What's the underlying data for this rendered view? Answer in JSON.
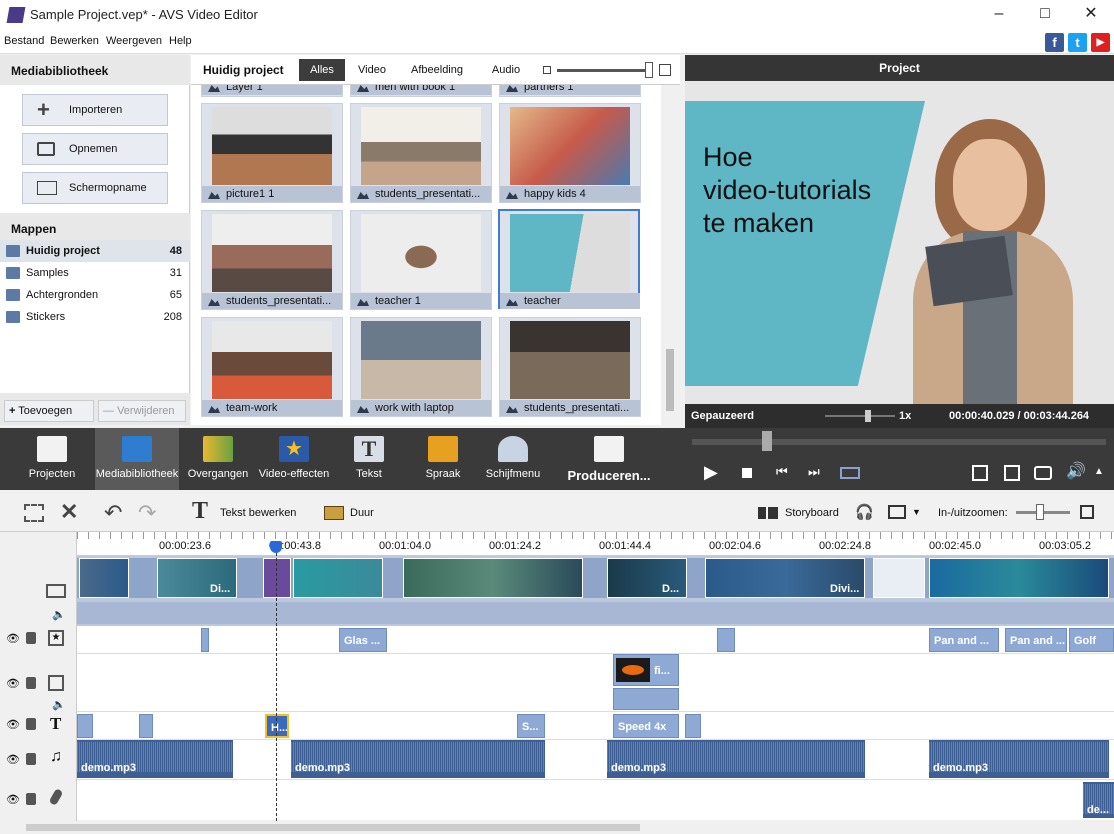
{
  "window": {
    "title": "Sample Project.vep* - AVS Video Editor"
  },
  "menu": [
    "Bestand",
    "Bewerken",
    "Weergeven",
    "Help"
  ],
  "social": [
    "f",
    "t",
    "▶"
  ],
  "library": {
    "title": "Mediabibliotheek",
    "buttons": [
      "Importeren",
      "Opnemen",
      "Schermopname"
    ],
    "folders_title": "Mappen",
    "folders": [
      {
        "name": "Huidig project",
        "count": "48"
      },
      {
        "name": "Samples",
        "count": "31"
      },
      {
        "name": "Achtergronden",
        "count": "65"
      },
      {
        "name": "Stickers",
        "count": "208"
      }
    ],
    "add": "Toevoegen",
    "remove": "Verwijderen"
  },
  "media": {
    "title": "Huidig project",
    "tabs": [
      "Alles",
      "Video",
      "Afbeelding",
      "Audio"
    ],
    "top_labels": [
      "Layer 1",
      "men with book 1",
      "partners 1"
    ],
    "items": [
      "picture1 1",
      "students_presentati...",
      "happy kids 4",
      "students_presentati...",
      "teacher 1",
      "teacher",
      "team-work",
      "work with laptop",
      "students_presentati..."
    ]
  },
  "project": {
    "title": "Project",
    "preview_text": [
      "Hoe",
      "video-tutorials",
      "te maken"
    ],
    "status": "Gepauzeerd",
    "speed": "1x",
    "time": "00:00:40.029 / 00:03:44.264"
  },
  "tools": [
    "Projecten",
    "Mediabibliotheek",
    "Overgangen",
    "Video-effecten",
    "Tekst",
    "Spraak",
    "Schijfmenu",
    "Produceren..."
  ],
  "edit": {
    "text_edit": "Tekst bewerken",
    "duration": "Duur",
    "storyboard": "Storyboard",
    "zoom": "In-/uitzoomen:"
  },
  "ruler": [
    "00:00:23.6",
    "00:00:43.8",
    "00:01:04.0",
    "00:01:24.2",
    "00:01:44.4",
    "00:02:04.6",
    "00:02:24.8",
    "00:02:45.0",
    "00:03:05.2"
  ],
  "video_clip_labels": [
    "Di...",
    "D...",
    "Divi..."
  ],
  "effects": [
    "Glas ...",
    "Pan and ...",
    "Pan and ...",
    "Golf"
  ],
  "overlay": "fi...",
  "texts": [
    "H...",
    "S...",
    "Speed 4x"
  ],
  "audio": [
    "demo.mp3",
    "demo.mp3",
    "demo.mp3",
    "demo.mp3",
    "de..."
  ],
  "colors": {
    "accent": "#3f7bd0",
    "track": "#8eaad4",
    "audio": "#3d5f94",
    "teal": "#5fb6c4"
  }
}
